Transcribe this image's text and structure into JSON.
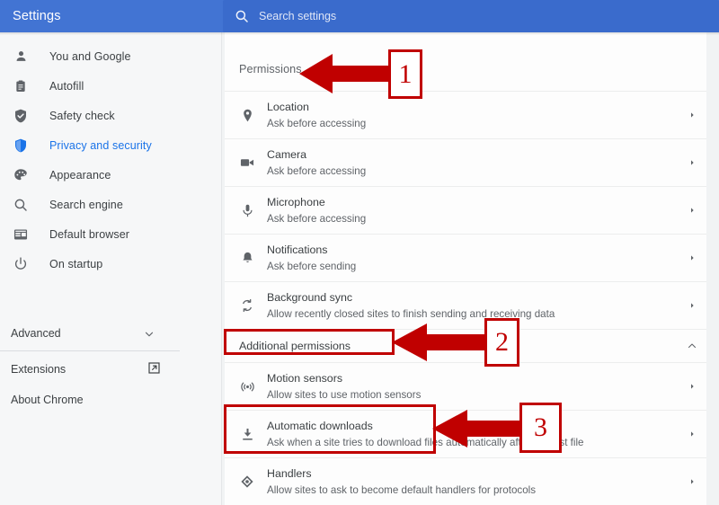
{
  "topbar": {
    "title": "Settings",
    "search_icon": "search-icon",
    "search_placeholder": "Search settings",
    "search_value": ""
  },
  "sidebar": {
    "items": [
      {
        "label": "You and Google",
        "icon": "person-icon",
        "active": false
      },
      {
        "label": "Autofill",
        "icon": "clipboard-icon",
        "active": false
      },
      {
        "label": "Safety check",
        "icon": "shield-check-icon",
        "active": false
      },
      {
        "label": "Privacy and security",
        "icon": "shield-icon",
        "active": true
      },
      {
        "label": "Appearance",
        "icon": "palette-icon",
        "active": false
      },
      {
        "label": "Search engine",
        "icon": "magnifier-icon",
        "active": false
      },
      {
        "label": "Default browser",
        "icon": "browser-window-icon",
        "active": false
      },
      {
        "label": "On startup",
        "icon": "power-icon",
        "active": false
      }
    ],
    "advanced": {
      "label": "Advanced",
      "icon": "chevron-down-icon"
    },
    "footer": [
      {
        "label": "Extensions",
        "icon": "external-link-icon"
      },
      {
        "label": "About Chrome",
        "icon": ""
      }
    ]
  },
  "main": {
    "section_title": "Permissions",
    "permissions": [
      {
        "title": "Location",
        "sub": "Ask before accessing",
        "icon": "location-pin-icon"
      },
      {
        "title": "Camera",
        "sub": "Ask before accessing",
        "icon": "camera-icon"
      },
      {
        "title": "Microphone",
        "sub": "Ask before accessing",
        "icon": "microphone-icon"
      },
      {
        "title": "Notifications",
        "sub": "Ask before sending",
        "icon": "bell-icon"
      },
      {
        "title": "Background sync",
        "sub": "Allow recently closed sites to finish sending and receiving data",
        "icon": "sync-icon"
      }
    ],
    "additional_permissions": {
      "label": "Additional permissions",
      "caret_icon": "chevron-up-icon",
      "expanded": true
    },
    "additional_items": [
      {
        "title": "Motion sensors",
        "sub": "Allow sites to use motion sensors",
        "icon": "motion-sensor-icon"
      },
      {
        "title": "Automatic downloads",
        "sub": "Ask when a site tries to download files automatically after the first file",
        "icon": "download-icon"
      },
      {
        "title": "Handlers",
        "sub": "Allow sites to ask to become default handlers for protocols",
        "icon": "handlers-icon"
      }
    ]
  },
  "annotations": {
    "color": "#c00000",
    "markers": [
      {
        "number": "1",
        "target": "Permissions"
      },
      {
        "number": "2",
        "target": "Additional permissions"
      },
      {
        "number": "3",
        "target": "Automatic downloads"
      }
    ]
  },
  "colors": {
    "topbar_blue": "#4274d3",
    "search_blue": "#3a6bcc",
    "accent_blue": "#1a73e8",
    "annotation_red": "#c00000",
    "sidebar_bg": "#f6f7f8",
    "content_bg": "#f1f3f4"
  }
}
